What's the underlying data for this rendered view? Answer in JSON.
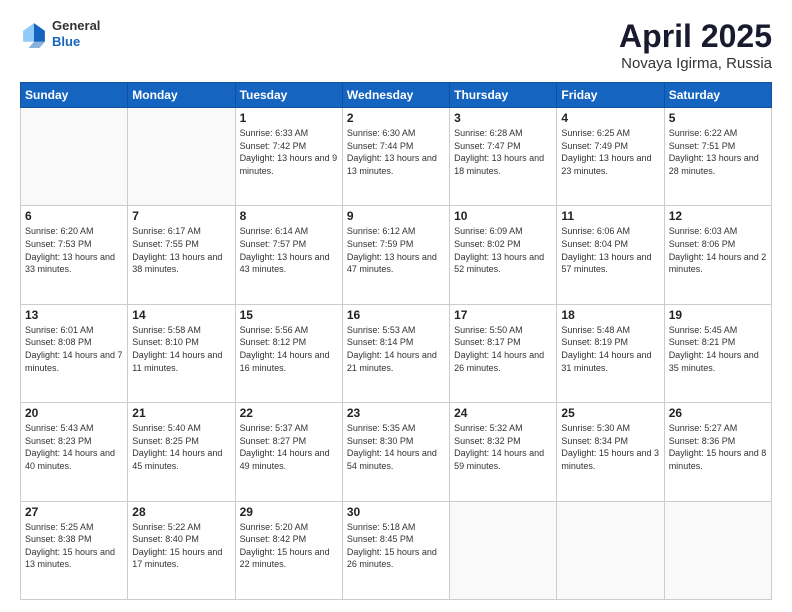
{
  "header": {
    "logo_general": "General",
    "logo_blue": "Blue",
    "title": "April 2025",
    "location": "Novaya Igirma, Russia"
  },
  "days_of_week": [
    "Sunday",
    "Monday",
    "Tuesday",
    "Wednesday",
    "Thursday",
    "Friday",
    "Saturday"
  ],
  "weeks": [
    [
      {
        "day": "",
        "info": ""
      },
      {
        "day": "",
        "info": ""
      },
      {
        "day": "1",
        "info": "Sunrise: 6:33 AM\nSunset: 7:42 PM\nDaylight: 13 hours and 9 minutes."
      },
      {
        "day": "2",
        "info": "Sunrise: 6:30 AM\nSunset: 7:44 PM\nDaylight: 13 hours and 13 minutes."
      },
      {
        "day": "3",
        "info": "Sunrise: 6:28 AM\nSunset: 7:47 PM\nDaylight: 13 hours and 18 minutes."
      },
      {
        "day": "4",
        "info": "Sunrise: 6:25 AM\nSunset: 7:49 PM\nDaylight: 13 hours and 23 minutes."
      },
      {
        "day": "5",
        "info": "Sunrise: 6:22 AM\nSunset: 7:51 PM\nDaylight: 13 hours and 28 minutes."
      }
    ],
    [
      {
        "day": "6",
        "info": "Sunrise: 6:20 AM\nSunset: 7:53 PM\nDaylight: 13 hours and 33 minutes."
      },
      {
        "day": "7",
        "info": "Sunrise: 6:17 AM\nSunset: 7:55 PM\nDaylight: 13 hours and 38 minutes."
      },
      {
        "day": "8",
        "info": "Sunrise: 6:14 AM\nSunset: 7:57 PM\nDaylight: 13 hours and 43 minutes."
      },
      {
        "day": "9",
        "info": "Sunrise: 6:12 AM\nSunset: 7:59 PM\nDaylight: 13 hours and 47 minutes."
      },
      {
        "day": "10",
        "info": "Sunrise: 6:09 AM\nSunset: 8:02 PM\nDaylight: 13 hours and 52 minutes."
      },
      {
        "day": "11",
        "info": "Sunrise: 6:06 AM\nSunset: 8:04 PM\nDaylight: 13 hours and 57 minutes."
      },
      {
        "day": "12",
        "info": "Sunrise: 6:03 AM\nSunset: 8:06 PM\nDaylight: 14 hours and 2 minutes."
      }
    ],
    [
      {
        "day": "13",
        "info": "Sunrise: 6:01 AM\nSunset: 8:08 PM\nDaylight: 14 hours and 7 minutes."
      },
      {
        "day": "14",
        "info": "Sunrise: 5:58 AM\nSunset: 8:10 PM\nDaylight: 14 hours and 11 minutes."
      },
      {
        "day": "15",
        "info": "Sunrise: 5:56 AM\nSunset: 8:12 PM\nDaylight: 14 hours and 16 minutes."
      },
      {
        "day": "16",
        "info": "Sunrise: 5:53 AM\nSunset: 8:14 PM\nDaylight: 14 hours and 21 minutes."
      },
      {
        "day": "17",
        "info": "Sunrise: 5:50 AM\nSunset: 8:17 PM\nDaylight: 14 hours and 26 minutes."
      },
      {
        "day": "18",
        "info": "Sunrise: 5:48 AM\nSunset: 8:19 PM\nDaylight: 14 hours and 31 minutes."
      },
      {
        "day": "19",
        "info": "Sunrise: 5:45 AM\nSunset: 8:21 PM\nDaylight: 14 hours and 35 minutes."
      }
    ],
    [
      {
        "day": "20",
        "info": "Sunrise: 5:43 AM\nSunset: 8:23 PM\nDaylight: 14 hours and 40 minutes."
      },
      {
        "day": "21",
        "info": "Sunrise: 5:40 AM\nSunset: 8:25 PM\nDaylight: 14 hours and 45 minutes."
      },
      {
        "day": "22",
        "info": "Sunrise: 5:37 AM\nSunset: 8:27 PM\nDaylight: 14 hours and 49 minutes."
      },
      {
        "day": "23",
        "info": "Sunrise: 5:35 AM\nSunset: 8:30 PM\nDaylight: 14 hours and 54 minutes."
      },
      {
        "day": "24",
        "info": "Sunrise: 5:32 AM\nSunset: 8:32 PM\nDaylight: 14 hours and 59 minutes."
      },
      {
        "day": "25",
        "info": "Sunrise: 5:30 AM\nSunset: 8:34 PM\nDaylight: 15 hours and 3 minutes."
      },
      {
        "day": "26",
        "info": "Sunrise: 5:27 AM\nSunset: 8:36 PM\nDaylight: 15 hours and 8 minutes."
      }
    ],
    [
      {
        "day": "27",
        "info": "Sunrise: 5:25 AM\nSunset: 8:38 PM\nDaylight: 15 hours and 13 minutes."
      },
      {
        "day": "28",
        "info": "Sunrise: 5:22 AM\nSunset: 8:40 PM\nDaylight: 15 hours and 17 minutes."
      },
      {
        "day": "29",
        "info": "Sunrise: 5:20 AM\nSunset: 8:42 PM\nDaylight: 15 hours and 22 minutes."
      },
      {
        "day": "30",
        "info": "Sunrise: 5:18 AM\nSunset: 8:45 PM\nDaylight: 15 hours and 26 minutes."
      },
      {
        "day": "",
        "info": ""
      },
      {
        "day": "",
        "info": ""
      },
      {
        "day": "",
        "info": ""
      }
    ]
  ]
}
